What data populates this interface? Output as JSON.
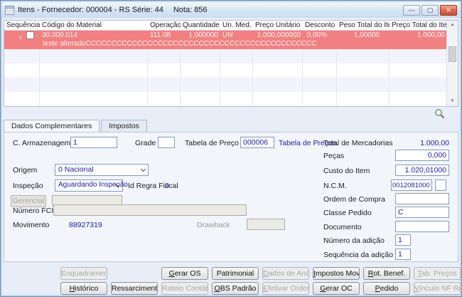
{
  "colors": {
    "accent_navy": "#1c1ca8",
    "selected_row": "#f28080",
    "close_button": "#c94f2f"
  },
  "window": {
    "title_main": "Itens - Fornecedor: 000004 - RS Série: 44",
    "title_nota": "Nota: 856",
    "controls": {
      "minimize": "—",
      "maximize": "▢",
      "close": "✕"
    }
  },
  "grid": {
    "columns": [
      "Sequência",
      "Código do Material",
      "Operação",
      "Quantidade",
      "Un. Med.",
      "Preço Unitário",
      "Desconto",
      "Peso Total do Item",
      "Preço Total do Item"
    ],
    "selected_row": {
      "sequencia": "1",
      "codigo_material": "30.000.014",
      "operacao": "111.08",
      "quantidade": "1,000000",
      "un_med": "UN",
      "preco_unitario": "1.000,000000",
      "desconto": "0,00%",
      "peso_total_item": "1,00000",
      "preco_total_item": "1.000,00",
      "descricao": "teste alteradoCCCCCCCCCCCCCCCCCCCCCCCCCCCCCCCCCCCCCCCCCCCCC"
    }
  },
  "tabs": {
    "dados_complementares": "Dados Complementares",
    "impostos": "Impostos"
  },
  "form_left": {
    "c_armazenagem_label": "C. Armazenagem",
    "c_armazenagem_value": "1",
    "grade_label": "Grade",
    "grade_value": "",
    "tabela_preco_label": "Tabela de Preço",
    "tabela_preco_value": "000006",
    "tabela_preco_desc": "Tabela de Preços.",
    "origem_label": "Origem",
    "origem_value": "0 Nacional",
    "inspecao_label": "Inspeção",
    "inspecao_value": "Aguardando Inspeção",
    "id_regra_fiscal_label": "Id Regra Fiscal",
    "id_regra_fiscal_value": "0",
    "gerencial_button": "Gerencial",
    "gerencial_value": "",
    "numero_fci_label": "Número FCI",
    "numero_fci_value": "",
    "movimento_label": "Movimento",
    "movimento_value": "88927319",
    "drawback_label": "Drawback",
    "drawback_value": ""
  },
  "form_right": {
    "total_mercadorias_label": "Total de Mercadorias",
    "total_mercadorias_value": "1.000,00",
    "pecas_label": "Peças",
    "pecas_value": "0,000",
    "custo_item_label": "Custo do Item",
    "custo_item_value": "1.020,01000",
    "ncm_label": "N.C.M.",
    "ncm_value": "0012081000",
    "ncm_extra": "",
    "ordem_compra_label": "Ordem de Compra",
    "ordem_compra_value": "",
    "classe_pedido_label": "Classe Pedido",
    "classe_pedido_value": "C",
    "documento_label": "Documento",
    "documento_value": "",
    "numero_adicao_label": "Número da adição",
    "numero_adicao_value": "1",
    "sequencia_adicao_label": "Sequência da adição",
    "sequencia_adicao_value": "1"
  },
  "footer": {
    "row1": [
      {
        "label": "Enquadramento",
        "enabled": false
      },
      {
        "label": "Gerar OS",
        "enabled": true
      },
      {
        "label": "Patrimonial",
        "enabled": true
      },
      {
        "label": "Dados de Análise",
        "enabled": false
      },
      {
        "label": "Impostos Movto",
        "enabled": true
      },
      {
        "label": "Rot. Benef.",
        "enabled": true
      },
      {
        "label": "Tab. Preços",
        "enabled": false
      }
    ],
    "row2": [
      {
        "label": "Histórico",
        "enabled": true
      },
      {
        "label": "Ressarcimento",
        "enabled": true
      },
      {
        "label": "Rateio Contábil",
        "enabled": false
      },
      {
        "label": "OBS Padrão",
        "enabled": true
      },
      {
        "label": "Efetivar Ordem",
        "enabled": false
      },
      {
        "label": "Gerar OC",
        "enabled": true
      },
      {
        "label": "Pedido",
        "enabled": true
      },
      {
        "label": "Vínculo NF Ref.",
        "enabled": false
      }
    ]
  }
}
